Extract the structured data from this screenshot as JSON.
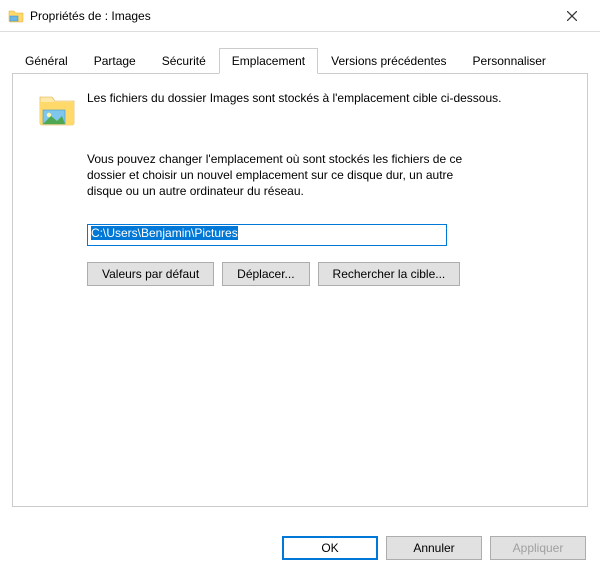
{
  "titlebar": {
    "title": "Propriétés de : Images"
  },
  "tabs": {
    "general": "Général",
    "sharing": "Partage",
    "security": "Sécurité",
    "location": "Emplacement",
    "previous": "Versions précédentes",
    "customize": "Personnaliser"
  },
  "location": {
    "desc_main": "Les fichiers du dossier Images sont stockés à l'emplacement cible ci-dessous.",
    "desc_sub": "Vous pouvez changer l'emplacement où sont stockés les fichiers de ce dossier et choisir un nouvel emplacement sur ce disque dur, un autre disque ou un autre ordinateur du réseau.",
    "path": "C:\\Users\\Benjamin\\Pictures",
    "buttons": {
      "restore_defaults": "Valeurs par défaut",
      "move": "Déplacer...",
      "find_target": "Rechercher la cible..."
    }
  },
  "dialog_buttons": {
    "ok": "OK",
    "cancel": "Annuler",
    "apply": "Appliquer"
  }
}
